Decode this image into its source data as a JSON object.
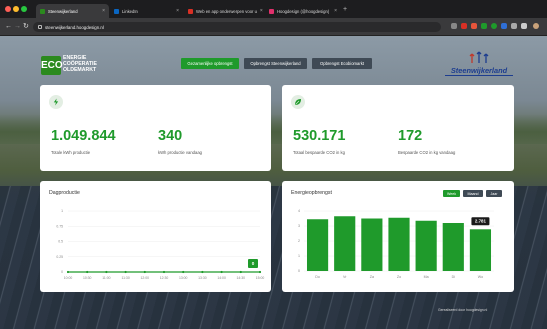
{
  "browser": {
    "tabs": [
      {
        "label": "Steenwijkerland",
        "active": true,
        "favicon_color": "#2b8a1e"
      },
      {
        "label": "LinkedIn",
        "active": false,
        "favicon_color": "#0a66c2"
      },
      {
        "label": "Web en app onderwerpen voor u",
        "active": false,
        "favicon_color": "#d93025"
      },
      {
        "label": "Hoogdesign (@hoogdesign)",
        "active": false,
        "favicon_color": "#e1306c"
      }
    ],
    "url": "steenwijkerland.hoogdesign.nl"
  },
  "header": {
    "logo": {
      "badge": "ECO",
      "lines": [
        "ENERGIE",
        "COÖPERATIE",
        "OLDEMARKT"
      ]
    },
    "nav": [
      "Gezamenlijke opbrengst",
      "Opbrengst Steenwijkerland",
      "Opbrengst Ecobiomarkt"
    ],
    "municipality": "Steenwijkerland"
  },
  "kpi_left": {
    "total_value": "1.049.844",
    "total_label": "Totale kWh productie",
    "today_value": "340",
    "today_label": "kWh productie vandaag"
  },
  "kpi_right": {
    "total_value": "530.171",
    "total_label": "Totaal bespaarde CO2 in kg",
    "today_value": "172",
    "today_label": "Bespaarde CO2 in kg vandaag"
  },
  "day_chart": {
    "title": "Dagproductie",
    "callout": "0"
  },
  "energy_chart": {
    "title": "Energieopbrengst",
    "buttons": [
      "Week",
      "Maand",
      "Jaar"
    ],
    "callout": "2.781"
  },
  "footer": "Gerealiseerd door hoogdesign.nl",
  "colors": {
    "brand_green": "#1f9a2b",
    "dark_button": "#3f4a55",
    "muni_blue": "#1d3d8f"
  },
  "chart_data": [
    {
      "type": "line",
      "title": "Dagproductie",
      "x": [
        "10:00",
        "10:30",
        "11:00",
        "11:30",
        "12:00",
        "12:30",
        "13:00",
        "13:30",
        "14:00",
        "14:30",
        "15:00"
      ],
      "yticks": [
        "0",
        "0.25",
        "0.5",
        "0.75",
        "1"
      ],
      "y": [
        0,
        0,
        0,
        0,
        0,
        0,
        0,
        0,
        0,
        0,
        0
      ],
      "ylim": [
        0,
        1
      ]
    },
    {
      "type": "bar",
      "title": "Energieopbrengst",
      "categories": [
        "Do",
        "Vr",
        "Za",
        "Zo",
        "Ma",
        "Di",
        "Wo"
      ],
      "values": [
        3.45,
        3.65,
        3.5,
        3.55,
        3.35,
        3.2,
        2.78
      ],
      "yticks": [
        "0",
        "1",
        "2",
        "3",
        "4"
      ],
      "ylim": [
        0,
        4
      ]
    }
  ]
}
